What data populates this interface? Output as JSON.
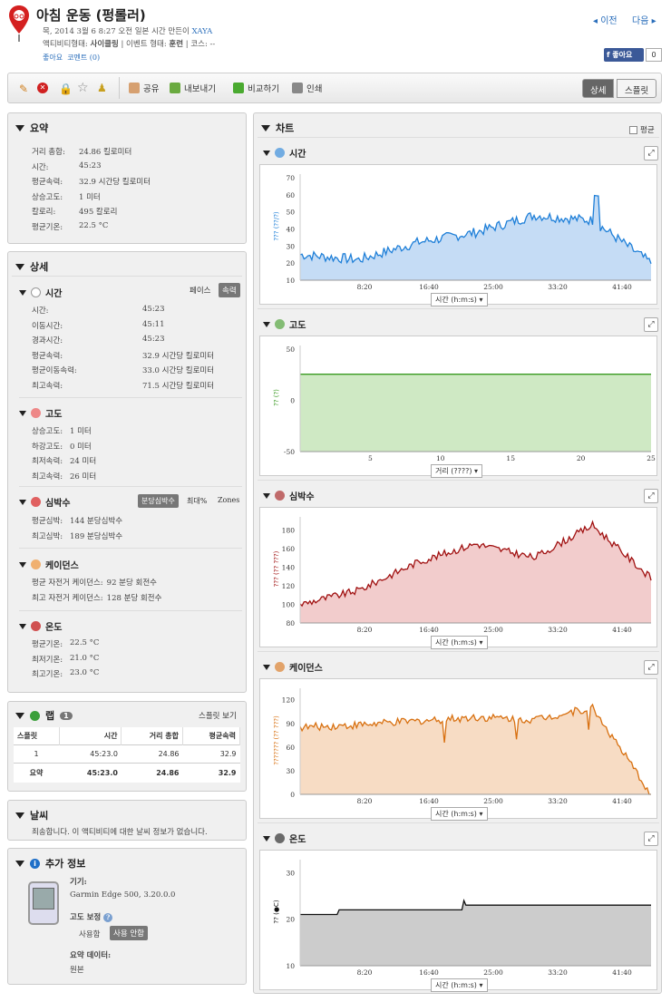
{
  "header": {
    "title": "아침 운동 (펑롤러)",
    "line1": "목, 2014 3월 6 8:27 오전 일본 시간 만든이",
    "owner": "XAYA",
    "line2_a": "액티비티형태:",
    "line2_b": "사이클링",
    "line2_c": "| 이벤트 형태:",
    "line2_d": "훈련",
    "line2_e": "| 코스:",
    "line2_f": "--",
    "like": "좋아요",
    "comment": "코멘트 (0)",
    "prev": "◂ 이전",
    "next": "다음 ▸",
    "fb_like": "좋아요",
    "fb_count": "0"
  },
  "toolbar": {
    "share": "공유",
    "export": "내보내기",
    "compare": "비교하기",
    "print": "인쇄",
    "detail": "상세",
    "split": "스플릿"
  },
  "summary": {
    "title": "요약",
    "rows": [
      {
        "k": "거리 총합:",
        "v": "24.86 킬로미터"
      },
      {
        "k": "시간:",
        "v": "45:23"
      },
      {
        "k": "평균속력:",
        "v": "32.9 시간당 킬로미터"
      },
      {
        "k": "상승고도:",
        "v": "1 미터"
      },
      {
        "k": "칼로리:",
        "v": "495 칼로리"
      },
      {
        "k": "평균기온:",
        "v": "22.5 °C"
      }
    ]
  },
  "detail": {
    "title": "상세",
    "time": {
      "title": "시간",
      "pace": "페이스",
      "speed": "속력",
      "rows": [
        {
          "k": "시간:",
          "v": "45:23"
        },
        {
          "k": "이동시간:",
          "v": "45:11"
        },
        {
          "k": "경과시간:",
          "v": "45:23"
        },
        {
          "k": "평균속력:",
          "v": "32.9 시간당 킬로미터"
        },
        {
          "k": "평균이동속력:",
          "v": "33.0 시간당 킬로미터"
        },
        {
          "k": "최고속력:",
          "v": "71.5 시간당 킬로미터"
        }
      ]
    },
    "elev": {
      "title": "고도",
      "rows": [
        {
          "k": "상승고도:",
          "v": "1 미터"
        },
        {
          "k": "하강고도:",
          "v": "0 미터"
        },
        {
          "k": "최저속력:",
          "v": "24 미터"
        },
        {
          "k": "최고속력:",
          "v": "26 미터"
        }
      ]
    },
    "hr": {
      "title": "심박수",
      "bpm": "분당심박수",
      "max": "최대%",
      "zones": "Zones",
      "rows": [
        {
          "k": "평균심박:",
          "v": "144 분당심박수"
        },
        {
          "k": "최고심박:",
          "v": "189 분당심박수"
        }
      ]
    },
    "cad": {
      "title": "케이던스",
      "rows": [
        {
          "k": "평균 자전거 케이던스:",
          "v": "92 분당 회전수"
        },
        {
          "k": "최고 자전거 케이던스:",
          "v": "128 분당 회전수"
        }
      ]
    },
    "temp": {
      "title": "온도",
      "rows": [
        {
          "k": "평균기온:",
          "v": "22.5 °C"
        },
        {
          "k": "최저기온:",
          "v": "21.0 °C"
        },
        {
          "k": "최고기온:",
          "v": "23.0 °C"
        }
      ]
    }
  },
  "laps": {
    "title": "랩",
    "count": "1",
    "split_view": "스플릿 보기",
    "headers": [
      "스플릿",
      "시간",
      "거리 총합",
      "평균속력"
    ],
    "rows": [
      [
        "1",
        "45:23.0",
        "24.86",
        "32.9"
      ]
    ],
    "total": [
      "요약",
      "45:23.0",
      "24.86",
      "32.9"
    ]
  },
  "weather": {
    "title": "날씨",
    "text": "죄송합니다. 이 액티비티에 대한 날씨 정보가 없습니다."
  },
  "extra": {
    "title": "추가 정보",
    "device_label": "기기:",
    "device": "Garmin Edge 500, 3.20.0.0",
    "elev_corr": "고도 보정",
    "use": "사용함",
    "no_use": "사용 안함",
    "summary_label": "요약 데이터:",
    "summary_val": "원본"
  },
  "charts_panel": {
    "title": "차트",
    "avg": "평균"
  },
  "charts": [
    {
      "id": "time",
      "title": "시간",
      "axis_label": "??? (??/?)",
      "xsel": "시간 (h:m:s)",
      "color": "#1e7fd8",
      "fill": "#c5dcf5",
      "ylabels": [
        "70",
        "60",
        "50",
        "40",
        "30",
        "20",
        "10"
      ],
      "xlabels": [
        "8:20",
        "16:40",
        "25:00",
        "33:20",
        "41:40"
      ]
    },
    {
      "id": "elev",
      "title": "고도",
      "axis_label": "?? (?)",
      "xsel": "거리 (????)",
      "color": "#3a9a22",
      "fill": "#cfe9c4",
      "ylabels": [
        "50",
        "0",
        "-50"
      ],
      "xlabels": [
        "5",
        "10",
        "15",
        "20",
        "25"
      ]
    },
    {
      "id": "hr",
      "title": "심박수",
      "axis_label": "??? (?? ???)",
      "xsel": "시간 (h:m:s)",
      "color": "#a01010",
      "fill": "#f2cccc",
      "ylabels": [
        "180",
        "160",
        "140",
        "120",
        "100",
        "80"
      ],
      "xlabels": [
        "8:20",
        "16:40",
        "25:00",
        "33:20",
        "41:40"
      ]
    },
    {
      "id": "cad",
      "title": "케이던스",
      "axis_label": "??????? (?? ???)",
      "xsel": "시간 (h:m:s)",
      "color": "#d87010",
      "fill": "#f7dcc4",
      "ylabels": [
        "120",
        "90",
        "60",
        "30",
        "0"
      ],
      "xlabels": [
        "8:20",
        "16:40",
        "25:00",
        "33:20",
        "41:40"
      ]
    },
    {
      "id": "temp",
      "title": "온도",
      "axis_label": "?? (●C)",
      "xsel": "시간 (h:m:s)",
      "color": "#111111",
      "fill": "#cccccc",
      "ylabels": [
        "30",
        "20",
        "10"
      ],
      "xlabels": [
        "8:20",
        "16:40",
        "25:00",
        "33:20",
        "41:40"
      ]
    }
  ],
  "chart_data": [
    {
      "type": "area",
      "title": "시간",
      "x_unit": "h:m:s",
      "ylim": [
        10,
        70
      ],
      "x": [
        "0:00",
        "8:20",
        "16:40",
        "25:00",
        "33:20",
        "41:40",
        "45:23"
      ],
      "values": [
        25,
        22,
        32,
        38,
        48,
        45,
        20
      ]
    },
    {
      "type": "area",
      "title": "고도",
      "ylim": [
        -50,
        50
      ],
      "x": [
        0,
        5,
        10,
        15,
        20,
        25
      ],
      "values": [
        25,
        25,
        25,
        25,
        26,
        26
      ]
    },
    {
      "type": "area",
      "title": "심박수",
      "ylim": [
        80,
        190
      ],
      "x": [
        "0:00",
        "8:20",
        "16:40",
        "25:00",
        "33:20",
        "41:40",
        "45:23"
      ],
      "values": [
        100,
        115,
        145,
        165,
        150,
        185,
        128
      ]
    },
    {
      "type": "area",
      "title": "케이던스",
      "ylim": [
        0,
        130
      ],
      "x": [
        "0:00",
        "8:20",
        "16:40",
        "25:00",
        "33:20",
        "41:40",
        "45:23"
      ],
      "values": [
        85,
        88,
        93,
        98,
        95,
        110,
        0
      ]
    },
    {
      "type": "area",
      "title": "온도",
      "ylim": [
        10,
        32
      ],
      "x": [
        "0:00",
        "8:20",
        "16:40",
        "25:00",
        "33:20",
        "41:40",
        "45:23"
      ],
      "values": [
        21,
        22,
        22,
        22.5,
        23,
        23,
        23
      ]
    }
  ]
}
